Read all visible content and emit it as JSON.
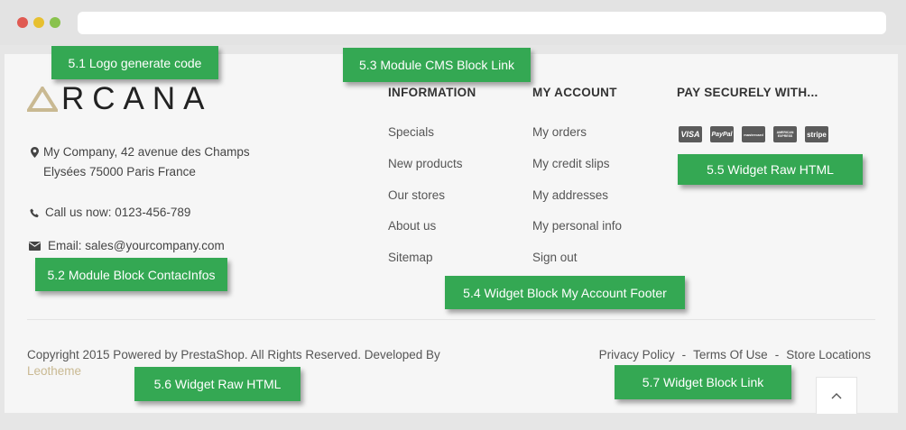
{
  "logo": {
    "text": "RCANA"
  },
  "contact": {
    "address_line1": "My Company, 42 avenue des Champs",
    "address_line2": "Elysées 75000 Paris France",
    "phone": "Call us now: 0123-456-789",
    "email": "Email: sales@yourcompany.com"
  },
  "information": {
    "title": "INFORMATION",
    "links": [
      "Specials",
      "New products",
      "Our stores",
      "About us",
      "Sitemap"
    ]
  },
  "my_account": {
    "title": "MY ACCOUNT",
    "links": [
      "My orders",
      "My credit slips",
      "My addresses",
      "My personal info",
      "Sign out"
    ]
  },
  "pay": {
    "title": "PAY SECURELY WITH...",
    "cards": [
      "VISA",
      "PayPal",
      "mastercard",
      "AMERICAN EXPRESS",
      "stripe"
    ]
  },
  "footer": {
    "copyright": "Copyright 2015 Powered by PrestaShop. All Rights Reserved. Developed By",
    "brand": "Leotheme",
    "links": [
      "Privacy Policy",
      "Terms Of Use",
      "Store Locations"
    ],
    "separator": "-"
  },
  "annotations": {
    "logo": "5.1 Logo generate code",
    "contact": "5.2 Module Block ContacInfos",
    "cms": "5.3 Module CMS Block Link",
    "account": "5.4 Widget Block My Account Footer",
    "raw_html_pay": "5.5 Widget Raw HTML",
    "raw_html_copyright": "5.6 Widget Raw HTML",
    "block_link": "5.7 Widget Block Link"
  },
  "colors": {
    "accent": "#c9b992",
    "annotation": "#34a853"
  },
  "icons": [
    "map-marker-icon",
    "phone-icon",
    "envelope-icon",
    "chevron-up-icon"
  ]
}
